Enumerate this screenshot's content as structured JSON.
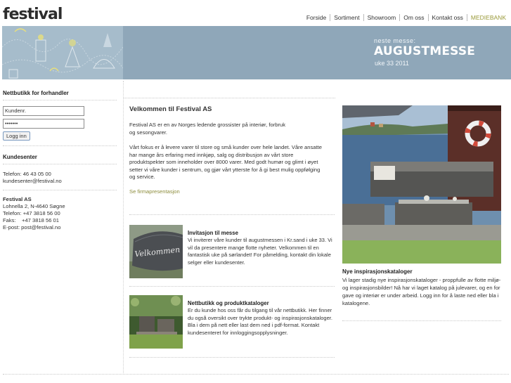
{
  "header": {
    "logo": "festival",
    "nav": [
      {
        "label": "Forside",
        "name": "nav-forside"
      },
      {
        "label": "Sortiment",
        "name": "nav-sortiment"
      },
      {
        "label": "Showroom",
        "name": "nav-showroom"
      },
      {
        "label": "Om oss",
        "name": "nav-om-oss"
      },
      {
        "label": "Kontakt oss",
        "name": "nav-kontakt-oss"
      },
      {
        "label": "MEDIEBANK",
        "name": "nav-mediebank"
      }
    ],
    "highlight_color": "#9a9a3a"
  },
  "banner": {
    "next_label": "neste messe:",
    "title": "AUGUSTMESSE",
    "week": "uke 33 2011",
    "bg_color": "#8fa7b9"
  },
  "login": {
    "heading": "Nettbutikk for forhandler",
    "customer_placeholder": "Kundenr.",
    "password_value": "•••••••",
    "button": "Logg inn"
  },
  "customer_center": {
    "heading": "Kundesenter",
    "phone": "Telefon: 46 43 05 00",
    "email": "kundesenter@festival.no"
  },
  "company": {
    "name": "Festival AS",
    "address": "Lohnella 2, N-4640 Søgne",
    "phone": "Telefon: +47 3818 56 00",
    "fax": "Faks:    +47 3818 56 01",
    "email": "E-post: post@festival.no"
  },
  "welcome": {
    "title": "Velkommen til Festival AS",
    "para1": "Festival AS er en av Norges ledende grossister på interiør, forbruk og sesongvarer.",
    "para2": "Vårt fokus er å levere varer til store og små kunder over hele landet. Våre ansatte har mange års erfaring med innkjøp, salg og distribusjon av vårt store produktspekter som inneholder over 8000 varer. Med godt humør og glimt i øyet setter vi våre kunder i sentrum, og gjør vårt ytterste for å gi best mulig oppfølging og service.",
    "link": "Se firmapresentasjon"
  },
  "articles": [
    {
      "title": "Invitasjon til messe",
      "body": "Vi inviterer våre kunder til augustmessen i Kr.sand i uke 33. Vi vil da presentere mange flotte nyheter. Velkommen til en fantastisk uke på sørlandet! For påmelding, kontakt din lokale selger eller kundesenter.",
      "thumb_text": "Velkommen"
    },
    {
      "title": "Nettbutikk og produktkataloger",
      "body": "Er du kunde hos oss får du tilgang til vår nettbutikk. Her finner du også oversikt over trykte produkt- og inspirasjonskataloger. Bla i dem på nett eller last dem ned i pdf-format. Kontakt kundesenteret for innloggingsopplysninger."
    }
  ],
  "inspiration": {
    "title": "Nye inspirasjonskataloger",
    "body": "Vi lager stadig nye inspirasjonskataloger - proppfulle av flotte miljø- og inspirasjonsbilder! Nå har vi laget katalog på julevarer, og en for gave og interiør er under arbeid. Logg inn for å laste ned eller bla i katalogene."
  }
}
